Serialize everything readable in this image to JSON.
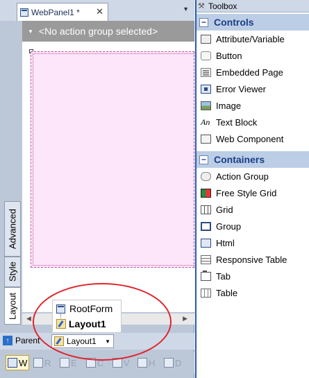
{
  "document": {
    "tab_title": "WebPanel1 *",
    "close_glyph": "✕",
    "menu_glyph": "▼"
  },
  "designer": {
    "action_group_text": "<No action group selected>",
    "action_group_arrow": "▼"
  },
  "side_tabs": [
    "Advanced",
    "Style",
    "Layout"
  ],
  "scroll": {
    "left": "◀",
    "right": "▶"
  },
  "breadcrumb": {
    "parent_label": "Parent",
    "parent_glyph": "↑",
    "current": "Layout1",
    "caret": "▼"
  },
  "popup": {
    "root": "RootForm",
    "child": "Layout1"
  },
  "parts": [
    "W",
    "R",
    "E",
    "C",
    "V",
    "H",
    "D"
  ],
  "toolbox": {
    "title": "Toolbox",
    "groups": [
      {
        "name": "Controls",
        "toggle": "−",
        "items": [
          "Attribute/Variable",
          "Button",
          "Embedded Page",
          "Error Viewer",
          "Image",
          "Text Block",
          "Web Component"
        ]
      },
      {
        "name": "Containers",
        "toggle": "−",
        "items": [
          "Action Group",
          "Free Style Grid",
          "Grid",
          "Group",
          "Html",
          "Responsive Table",
          "Tab",
          "Table"
        ]
      }
    ]
  },
  "colors": {
    "highlight": "#e0242b",
    "accent": "#2b5fa8",
    "form_background": "#fde6f9"
  }
}
